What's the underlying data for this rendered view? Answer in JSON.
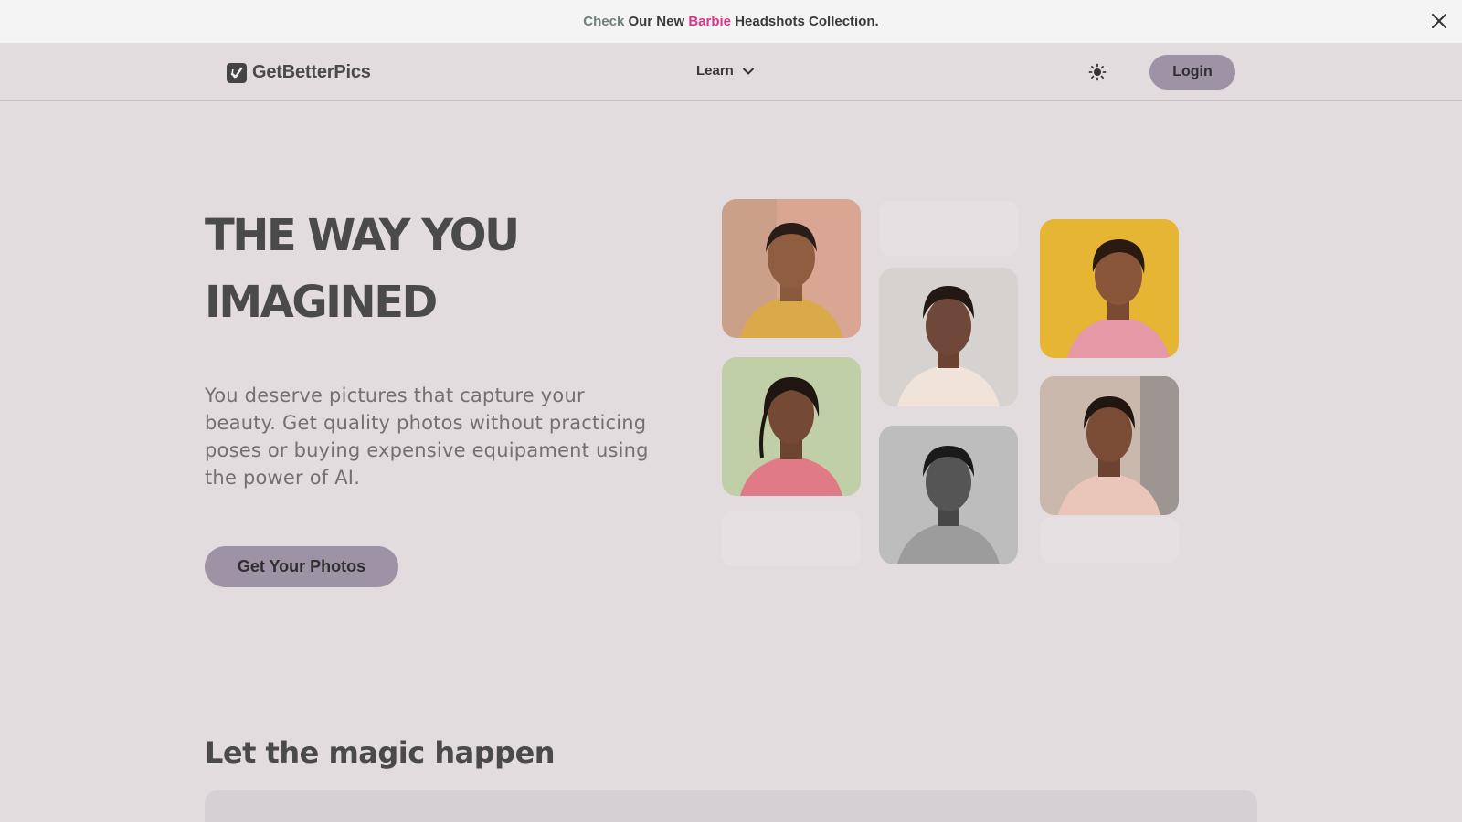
{
  "announcement": {
    "check": "Check",
    "our_new": "Our New",
    "barbie": "Barbie",
    "rest": "Headshots Collection."
  },
  "nav": {
    "brand": "GetBetterPics",
    "learn": "Learn",
    "login": "Login"
  },
  "hero": {
    "title_line1": "THE WAY YOU",
    "title_line2": "IMAGINED",
    "subtitle": "You deserve pictures that capture your beauty. Get quality photos without practicing poses or buying expensive equipament using the power of AI.",
    "cta": "Get Your Photos"
  },
  "section": {
    "title": "Let the magic happen"
  },
  "colors": {
    "background": "#e3dcdf",
    "accent_button": "#9d93a4",
    "barbie_pink": "#e0338a",
    "check_green": "#6f7f7b"
  },
  "icons": {
    "close": "close-icon",
    "logo": "logo-icon",
    "chevron": "chevron-down-icon",
    "theme": "sun-icon"
  }
}
